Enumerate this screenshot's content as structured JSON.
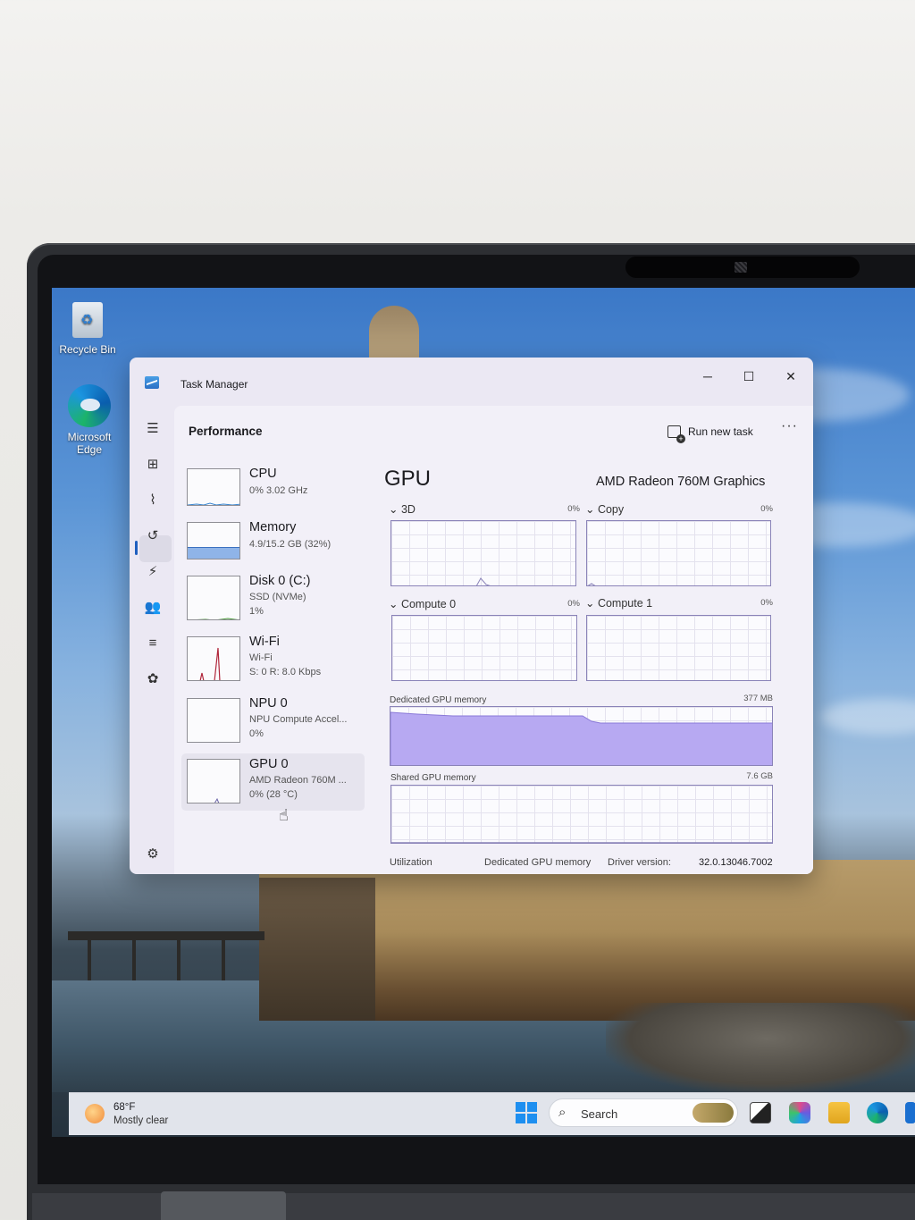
{
  "desktop": {
    "icons": [
      {
        "label": "Recycle Bin"
      },
      {
        "label": "Microsoft Edge"
      }
    ]
  },
  "window": {
    "title": "Task Manager"
  },
  "toolbar": {
    "page_title": "Performance",
    "run_new_task": "Run new task",
    "more": "···"
  },
  "devices": [
    {
      "name": "CPU",
      "line1": "0% 3.02 GHz",
      "line2": ""
    },
    {
      "name": "Memory",
      "line1": "4.9/15.2 GB (32%)",
      "line2": ""
    },
    {
      "name": "Disk 0 (C:)",
      "line1": "SSD (NVMe)",
      "line2": "1%"
    },
    {
      "name": "Wi-Fi",
      "line1": "Wi-Fi",
      "line2": "S: 0 R: 8.0 Kbps"
    },
    {
      "name": "NPU 0",
      "line1": "NPU Compute Accel...",
      "line2": "0%"
    },
    {
      "name": "GPU 0",
      "line1": "AMD Radeon 760M ...",
      "line2": "0% (28 °C)"
    }
  ],
  "gpu": {
    "title": "GPU",
    "model": "AMD Radeon 760M Graphics",
    "engines": [
      {
        "label": "3D",
        "pct": "0%"
      },
      {
        "label": "Copy",
        "pct": "0%"
      },
      {
        "label": "Compute 0",
        "pct": "0%"
      },
      {
        "label": "Compute 1",
        "pct": "0%"
      }
    ],
    "dedicated_label": "Dedicated GPU memory",
    "dedicated_max": "377 MB",
    "shared_label": "Shared GPU memory",
    "shared_max": "7.6 GB",
    "bottom": {
      "utilization": "Utilization",
      "dedicated": "Dedicated GPU memory",
      "driver_label": "Driver version:",
      "driver_value": "32.0.13046.7002"
    }
  },
  "taskbar": {
    "weather_temp": "68°F",
    "weather_desc": "Mostly clear",
    "search": "Search"
  },
  "colors": {
    "accent": "#1f5fbf",
    "gpu_graph": "#8a83b8",
    "memory_fill": "#b7a9f2",
    "wifi_spike": "#b0263b"
  }
}
